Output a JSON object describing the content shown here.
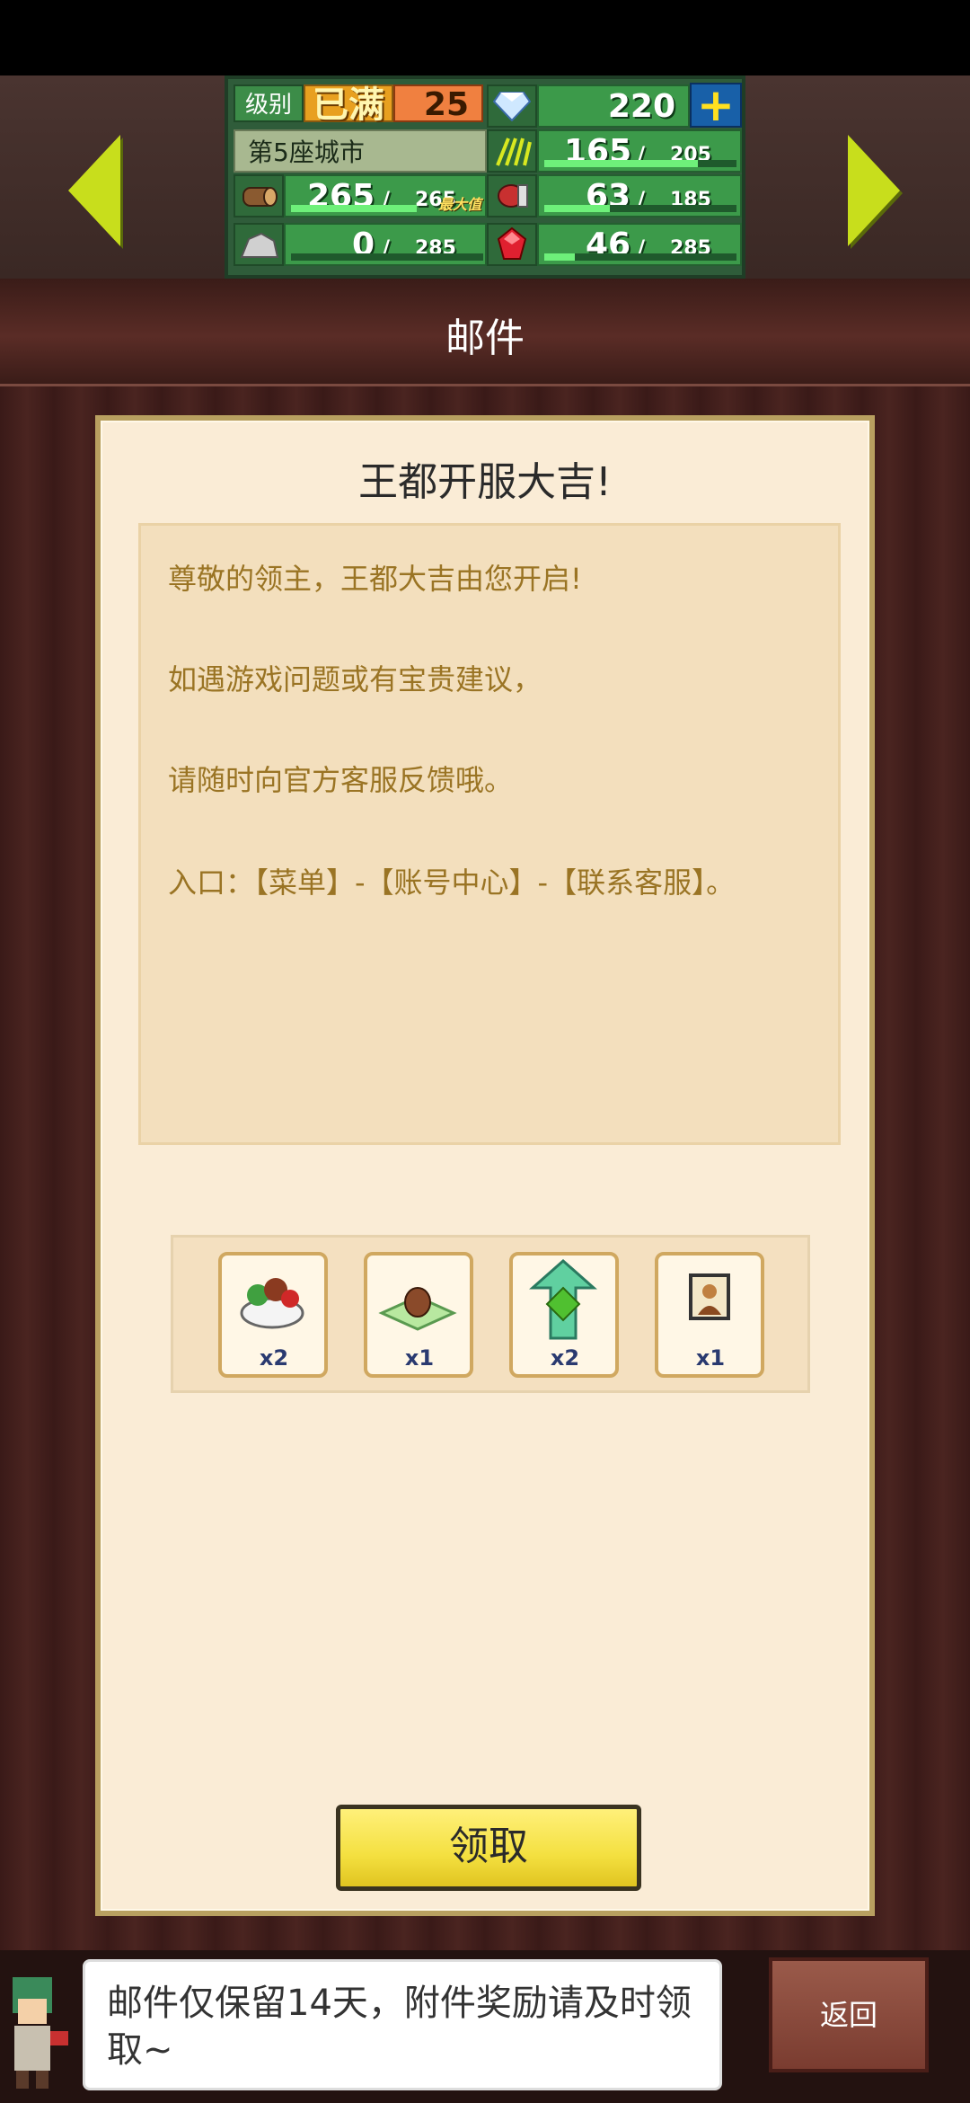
{
  "topbar": {
    "level_label": "级别",
    "level_max": "已满",
    "level_value": "25",
    "gems": "220",
    "city_name": "第5座城市",
    "food": {
      "current": "165",
      "max": "205",
      "fill": 0.8
    },
    "wood": {
      "current": "265",
      "max": "265",
      "max_tag": "最大值",
      "fill": 1.0
    },
    "meat": {
      "current": "63",
      "max": "185",
      "fill": 0.34
    },
    "stone": {
      "current": "0",
      "max": "285",
      "fill": 0.0
    },
    "ruby": {
      "current": "46",
      "max": "285",
      "fill": 0.16
    },
    "slash": "/"
  },
  "header": {
    "title": "邮件"
  },
  "mail": {
    "title": "王都开服大吉!",
    "lines": [
      "尊敬的领主，王都大吉由您开启!",
      "如遇游戏问题或有宝贵建议，",
      "请随时向官方客服反馈哦。",
      "入口：【菜单】-【账号中心】-【联系客服】。"
    ],
    "rewards": [
      {
        "icon": "food-bowl-icon",
        "qty": "x2"
      },
      {
        "icon": "building-plot-icon",
        "qty": "x1"
      },
      {
        "icon": "upgrade-arrow-icon",
        "qty": "x2"
      },
      {
        "icon": "portrait-icon",
        "qty": "x1"
      }
    ],
    "claim_label": "领取"
  },
  "footer": {
    "tip": "邮件仅保留14天，附件奖励请及时领取~",
    "back_label": "返回"
  },
  "colors": {
    "accent_green": "#3c9a4a",
    "button_yellow": "#f4e040",
    "text_brown": "#9a7424"
  }
}
